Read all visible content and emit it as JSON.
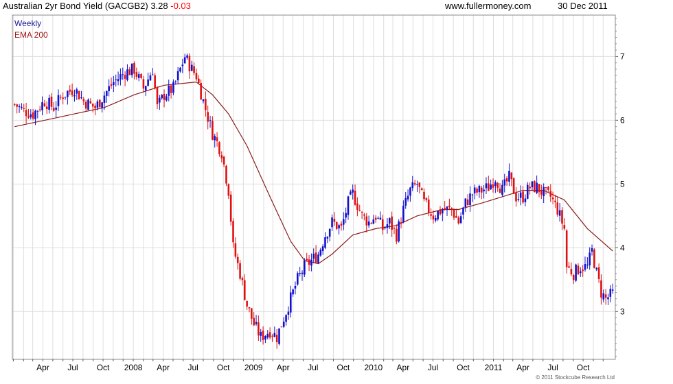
{
  "header": {
    "title": "Australian 2yr Bond Yield (GACGB2) 3.28",
    "change": "-0.03",
    "site": "www.fullermoney.com",
    "date": "30 Dec 2011"
  },
  "legend": {
    "weekly": "Weekly",
    "ema": "EMA 200"
  },
  "copyright": "© 2011 Stockcube Research Ltd",
  "colors": {
    "up": "#1010d0",
    "down": "#e01010",
    "ema": "#8b1a1a",
    "grid": "#dddddd"
  },
  "chart_data": {
    "type": "candlestick",
    "frequency": "weekly",
    "y_ticks": [
      3,
      4,
      5,
      6,
      7
    ],
    "ylim": [
      2.25,
      7.65
    ],
    "x_ticks": [
      "Apr",
      "Jul",
      "Oct",
      "2008",
      "Apr",
      "Jul",
      "Oct",
      "2009",
      "Apr",
      "Jul",
      "Oct",
      "2010",
      "Apr",
      "Jul",
      "Oct",
      "2011",
      "Apr",
      "Jul",
      "Oct"
    ],
    "series": [
      {
        "name": "Weekly",
        "close_points": [
          [
            "2007-01-05",
            6.25
          ],
          [
            "2007-02-02",
            6.15
          ],
          [
            "2007-03-02",
            6.1
          ],
          [
            "2007-04-06",
            6.3
          ],
          [
            "2007-05-04",
            6.2
          ],
          [
            "2007-06-01",
            6.4
          ],
          [
            "2007-07-06",
            6.5
          ],
          [
            "2007-08-03",
            6.3
          ],
          [
            "2007-09-07",
            6.2
          ],
          [
            "2007-10-05",
            6.4
          ],
          [
            "2007-11-02",
            6.6
          ],
          [
            "2007-12-07",
            6.75
          ],
          [
            "2008-01-04",
            6.8
          ],
          [
            "2008-02-01",
            6.5
          ],
          [
            "2008-02-29",
            6.8
          ],
          [
            "2008-03-14",
            6.2
          ],
          [
            "2008-04-04",
            6.4
          ],
          [
            "2008-05-02",
            6.5
          ],
          [
            "2008-06-06",
            7.0
          ],
          [
            "2008-06-27",
            6.8
          ],
          [
            "2008-07-11",
            6.7
          ],
          [
            "2008-08-01",
            6.3
          ],
          [
            "2008-08-29",
            5.8
          ],
          [
            "2008-09-26",
            5.5
          ],
          [
            "2008-10-17",
            4.9
          ],
          [
            "2008-10-31",
            4.0
          ],
          [
            "2008-11-21",
            3.6
          ],
          [
            "2008-12-12",
            3.1
          ],
          [
            "2009-01-02",
            2.8
          ],
          [
            "2009-01-23",
            2.6
          ],
          [
            "2009-02-20",
            2.7
          ],
          [
            "2009-03-13",
            2.6
          ],
          [
            "2009-04-03",
            2.9
          ],
          [
            "2009-04-24",
            3.2
          ],
          [
            "2009-05-15",
            3.5
          ],
          [
            "2009-06-05",
            3.7
          ],
          [
            "2009-06-26",
            3.8
          ],
          [
            "2009-07-17",
            3.9
          ],
          [
            "2009-08-07",
            4.2
          ],
          [
            "2009-08-28",
            4.4
          ],
          [
            "2009-09-25",
            4.3
          ],
          [
            "2009-10-16",
            4.7
          ],
          [
            "2009-10-30",
            4.85
          ],
          [
            "2009-11-27",
            4.5
          ],
          [
            "2009-12-18",
            4.4
          ],
          [
            "2010-01-08",
            4.5
          ],
          [
            "2010-01-29",
            4.3
          ],
          [
            "2010-02-19",
            4.4
          ],
          [
            "2010-03-12",
            4.2
          ],
          [
            "2010-04-02",
            4.6
          ],
          [
            "2010-04-23",
            4.9
          ],
          [
            "2010-05-14",
            5.0
          ],
          [
            "2010-06-04",
            4.7
          ],
          [
            "2010-07-02",
            4.5
          ],
          [
            "2010-07-30",
            4.6
          ],
          [
            "2010-08-27",
            4.6
          ],
          [
            "2010-09-17",
            4.4
          ],
          [
            "2010-10-08",
            4.7
          ],
          [
            "2010-10-29",
            4.85
          ],
          [
            "2010-11-26",
            4.9
          ],
          [
            "2010-12-17",
            4.95
          ],
          [
            "2011-01-07",
            5.1
          ],
          [
            "2011-01-28",
            4.9
          ],
          [
            "2011-02-18",
            5.1
          ],
          [
            "2011-03-11",
            4.8
          ],
          [
            "2011-04-01",
            4.8
          ],
          [
            "2011-04-22",
            4.95
          ],
          [
            "2011-05-13",
            4.95
          ],
          [
            "2011-06-03",
            4.85
          ],
          [
            "2011-06-24",
            4.8
          ],
          [
            "2011-07-15",
            4.6
          ],
          [
            "2011-08-05",
            4.3
          ],
          [
            "2011-08-12",
            3.7
          ],
          [
            "2011-09-02",
            3.6
          ],
          [
            "2011-09-23",
            3.7
          ],
          [
            "2011-10-14",
            3.7
          ],
          [
            "2011-10-28",
            3.95
          ],
          [
            "2011-11-11",
            3.6
          ],
          [
            "2011-11-25",
            3.3
          ],
          [
            "2011-12-09",
            3.2
          ],
          [
            "2011-12-30",
            3.28
          ]
        ]
      },
      {
        "name": "EMA 200",
        "points": [
          [
            "2007-01-05",
            5.9
          ],
          [
            "2007-04-06",
            6.0
          ],
          [
            "2007-07-06",
            6.1
          ],
          [
            "2007-10-05",
            6.2
          ],
          [
            "2008-01-04",
            6.4
          ],
          [
            "2008-04-04",
            6.55
          ],
          [
            "2008-07-11",
            6.6
          ],
          [
            "2008-08-29",
            6.4
          ],
          [
            "2008-10-17",
            6.1
          ],
          [
            "2008-12-12",
            5.6
          ],
          [
            "2009-02-20",
            4.8
          ],
          [
            "2009-04-24",
            4.1
          ],
          [
            "2009-06-05",
            3.8
          ],
          [
            "2009-07-17",
            3.75
          ],
          [
            "2009-08-28",
            3.9
          ],
          [
            "2009-10-30",
            4.2
          ],
          [
            "2010-01-08",
            4.3
          ],
          [
            "2010-03-12",
            4.35
          ],
          [
            "2010-05-14",
            4.5
          ],
          [
            "2010-07-30",
            4.6
          ],
          [
            "2010-09-17",
            4.6
          ],
          [
            "2010-11-26",
            4.7
          ],
          [
            "2011-01-28",
            4.8
          ],
          [
            "2011-04-01",
            4.9
          ],
          [
            "2011-06-03",
            4.9
          ],
          [
            "2011-08-05",
            4.75
          ],
          [
            "2011-10-14",
            4.3
          ],
          [
            "2011-12-30",
            3.95
          ]
        ]
      }
    ]
  }
}
